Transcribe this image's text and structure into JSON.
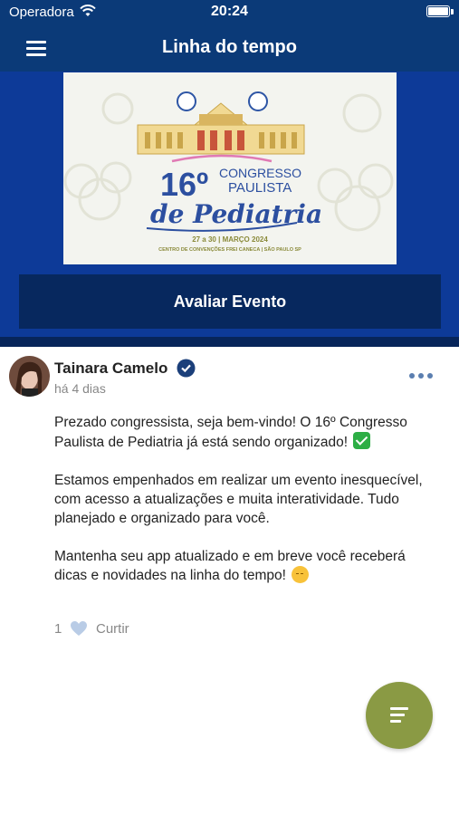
{
  "status_bar": {
    "carrier": "Operadora",
    "time": "20:24",
    "icons": [
      "wifi-icon",
      "battery-icon"
    ]
  },
  "app_bar": {
    "title": "Linha do tempo",
    "menu_icon": "hamburger-menu-icon"
  },
  "banner": {
    "edition": "16º",
    "line1": "CONGRESSO",
    "line2": "PAULISTA",
    "script": "de Pediatria",
    "date": "27 a 30 | MARÇO 2024",
    "venue": "CENTRO DE CONVENÇÕES FREI CANECA | SÃO PAULO SP"
  },
  "rate_button": {
    "label": "Avaliar Evento"
  },
  "post": {
    "author": "Tainara Camelo",
    "verified_icon": "verified-check-icon",
    "time_ago": "há 4 dias",
    "menu_icon": "more-horizontal-icon",
    "paragraph1": "Prezado congressista, seja bem-vindo! O 16º Congresso Paulista de Pediatria já está sendo organizado!",
    "paragraph2": "Estamos empenhados em realizar um evento inesquecível, com acesso a atualizações e muita interatividade. Tudo planejado e organizado para você.",
    "paragraph3": "Mantenha seu app atualizado e em breve você receberá dicas e novidades na linha do tempo!",
    "like_count": "1",
    "like_label": "Curtir",
    "like_icon": "heart-icon"
  },
  "fab": {
    "icon": "sort-filter-icon"
  },
  "colors": {
    "header": "#0b3a78",
    "hero": "#0d3a98",
    "button": "#07285e",
    "fab": "#8a9a44",
    "accent": "#1b3f7a"
  }
}
